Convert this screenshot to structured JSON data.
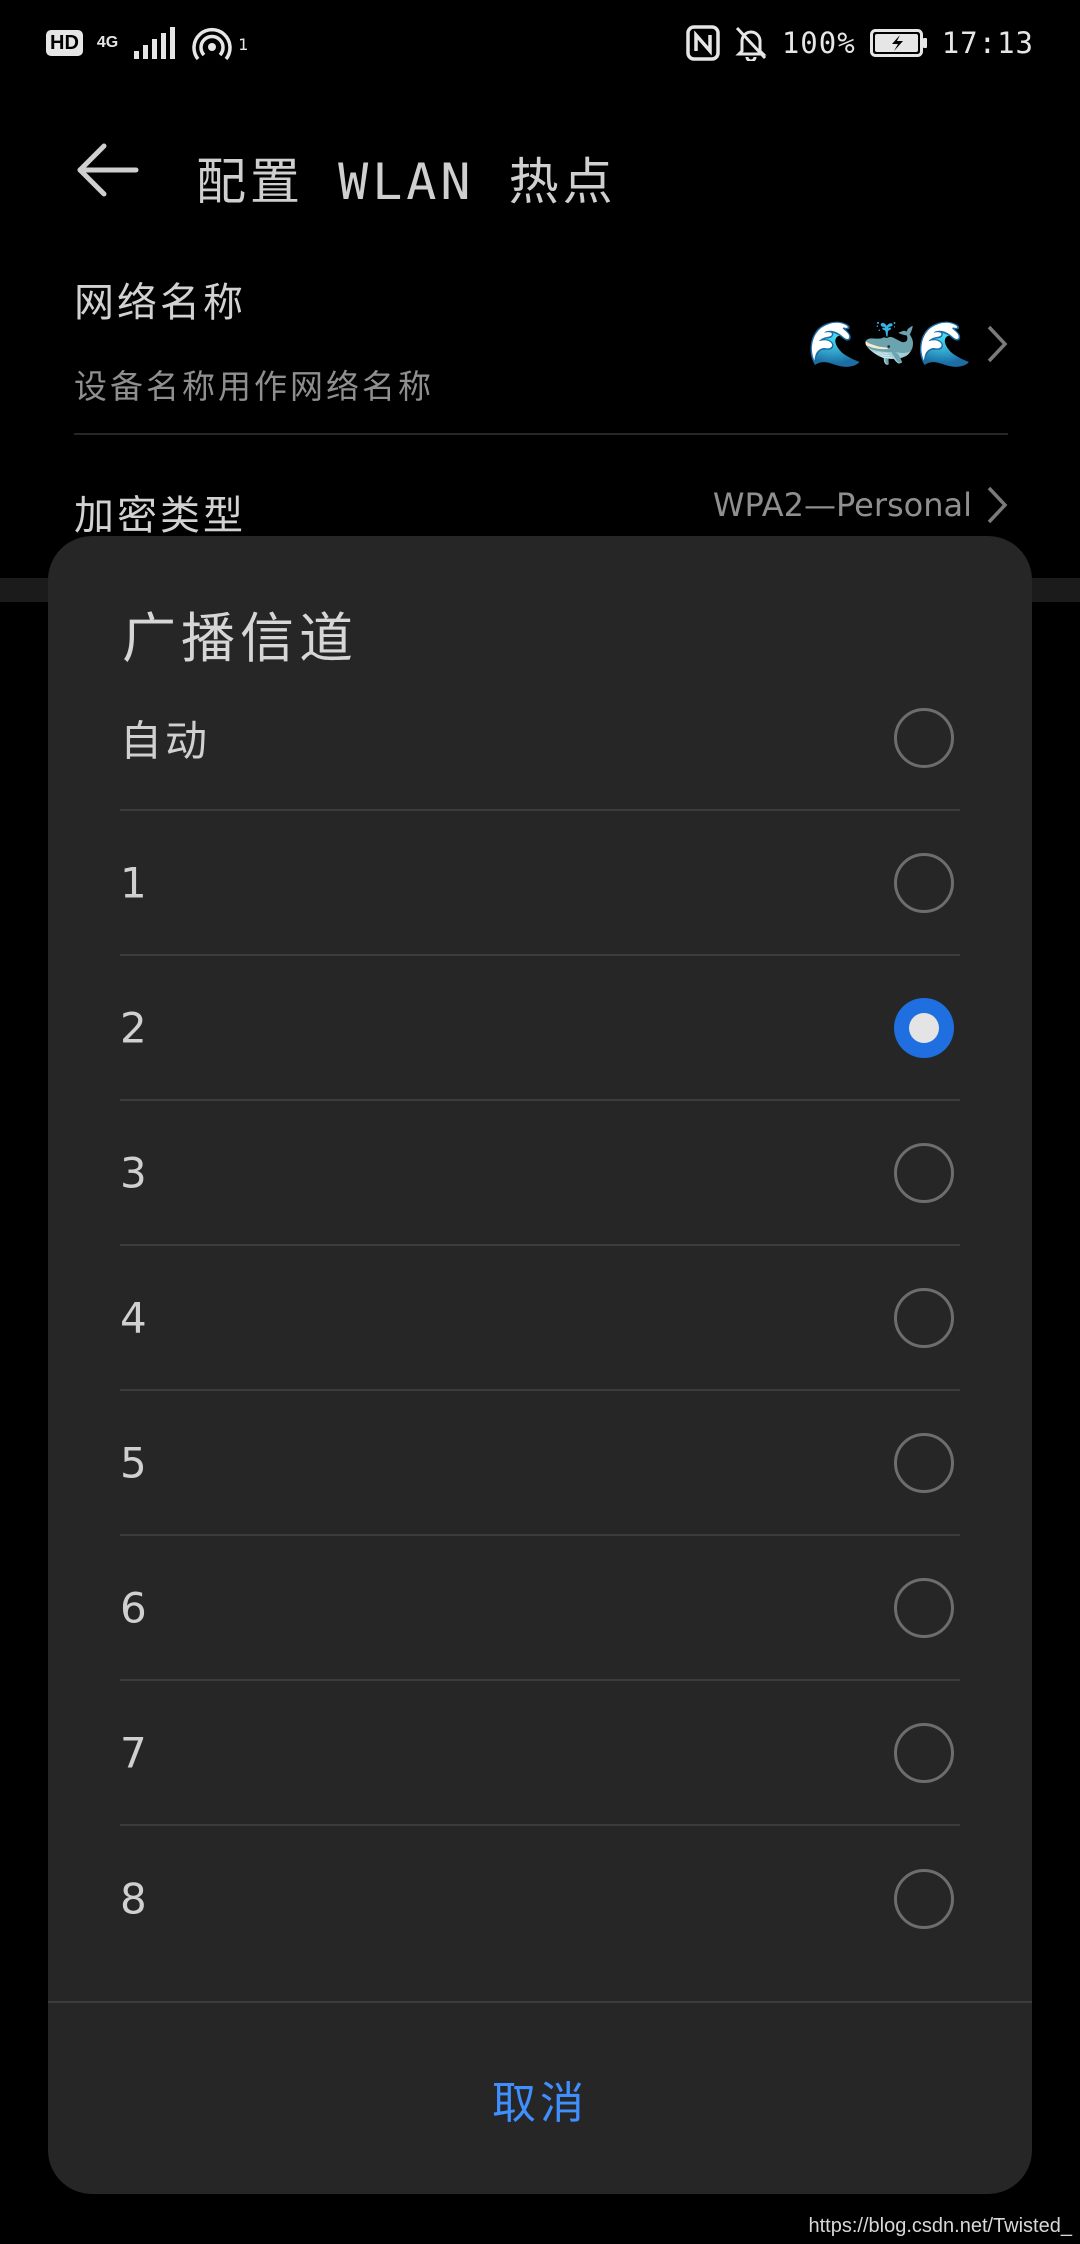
{
  "status_bar": {
    "hd": "HD",
    "network_type": "4G",
    "hotspot_count": "1",
    "battery_percent": "100%",
    "time": "17:13",
    "icons": [
      "hd-icon",
      "signal-icon",
      "hotspot-icon",
      "nfc-icon",
      "bell-off-icon",
      "battery-charging-icon"
    ]
  },
  "header": {
    "title": "配置 WLAN 热点"
  },
  "settings": {
    "network_name": {
      "title": "网络名称",
      "subtitle": "设备名称用作网络名称",
      "value": "🌊🐳🌊"
    },
    "encryption": {
      "title": "加密类型",
      "value": "WPA2—Personal"
    }
  },
  "dialog": {
    "title": "广播信道",
    "selected": "2",
    "options": [
      {
        "label": "自动",
        "checked": false
      },
      {
        "label": "1",
        "checked": false
      },
      {
        "label": "2",
        "checked": true
      },
      {
        "label": "3",
        "checked": false
      },
      {
        "label": "4",
        "checked": false
      },
      {
        "label": "5",
        "checked": false
      },
      {
        "label": "6",
        "checked": false
      },
      {
        "label": "7",
        "checked": false
      },
      {
        "label": "8",
        "checked": false
      }
    ],
    "cancel_label": "取消"
  },
  "colors": {
    "accent": "#1f6fe0",
    "cancel_text": "#3f8fff",
    "dialog_bg": "#262626"
  },
  "watermark": "https://blog.csdn.net/Twisted_"
}
